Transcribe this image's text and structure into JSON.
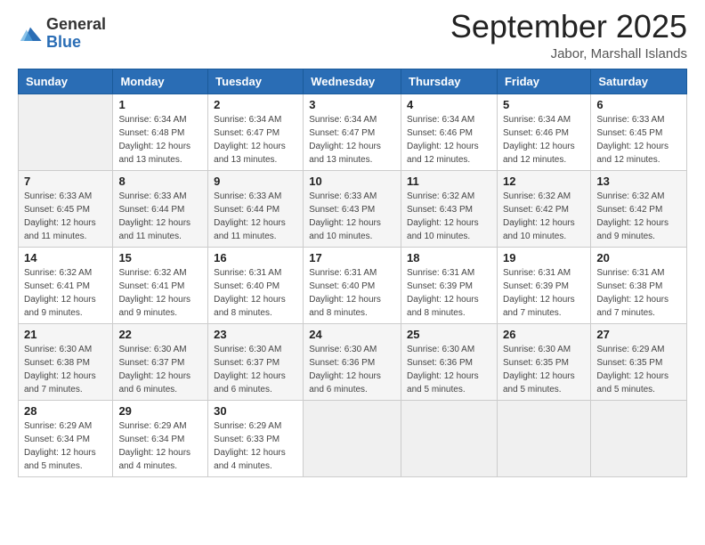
{
  "logo": {
    "general": "General",
    "blue": "Blue"
  },
  "title": "September 2025",
  "subtitle": "Jabor, Marshall Islands",
  "headers": [
    "Sunday",
    "Monday",
    "Tuesday",
    "Wednesday",
    "Thursday",
    "Friday",
    "Saturday"
  ],
  "weeks": [
    [
      {
        "day": "",
        "detail": ""
      },
      {
        "day": "1",
        "detail": "Sunrise: 6:34 AM\nSunset: 6:48 PM\nDaylight: 12 hours\nand 13 minutes."
      },
      {
        "day": "2",
        "detail": "Sunrise: 6:34 AM\nSunset: 6:47 PM\nDaylight: 12 hours\nand 13 minutes."
      },
      {
        "day": "3",
        "detail": "Sunrise: 6:34 AM\nSunset: 6:47 PM\nDaylight: 12 hours\nand 13 minutes."
      },
      {
        "day": "4",
        "detail": "Sunrise: 6:34 AM\nSunset: 6:46 PM\nDaylight: 12 hours\nand 12 minutes."
      },
      {
        "day": "5",
        "detail": "Sunrise: 6:34 AM\nSunset: 6:46 PM\nDaylight: 12 hours\nand 12 minutes."
      },
      {
        "day": "6",
        "detail": "Sunrise: 6:33 AM\nSunset: 6:45 PM\nDaylight: 12 hours\nand 12 minutes."
      }
    ],
    [
      {
        "day": "7",
        "detail": "Sunrise: 6:33 AM\nSunset: 6:45 PM\nDaylight: 12 hours\nand 11 minutes."
      },
      {
        "day": "8",
        "detail": "Sunrise: 6:33 AM\nSunset: 6:44 PM\nDaylight: 12 hours\nand 11 minutes."
      },
      {
        "day": "9",
        "detail": "Sunrise: 6:33 AM\nSunset: 6:44 PM\nDaylight: 12 hours\nand 11 minutes."
      },
      {
        "day": "10",
        "detail": "Sunrise: 6:33 AM\nSunset: 6:43 PM\nDaylight: 12 hours\nand 10 minutes."
      },
      {
        "day": "11",
        "detail": "Sunrise: 6:32 AM\nSunset: 6:43 PM\nDaylight: 12 hours\nand 10 minutes."
      },
      {
        "day": "12",
        "detail": "Sunrise: 6:32 AM\nSunset: 6:42 PM\nDaylight: 12 hours\nand 10 minutes."
      },
      {
        "day": "13",
        "detail": "Sunrise: 6:32 AM\nSunset: 6:42 PM\nDaylight: 12 hours\nand 9 minutes."
      }
    ],
    [
      {
        "day": "14",
        "detail": "Sunrise: 6:32 AM\nSunset: 6:41 PM\nDaylight: 12 hours\nand 9 minutes."
      },
      {
        "day": "15",
        "detail": "Sunrise: 6:32 AM\nSunset: 6:41 PM\nDaylight: 12 hours\nand 9 minutes."
      },
      {
        "day": "16",
        "detail": "Sunrise: 6:31 AM\nSunset: 6:40 PM\nDaylight: 12 hours\nand 8 minutes."
      },
      {
        "day": "17",
        "detail": "Sunrise: 6:31 AM\nSunset: 6:40 PM\nDaylight: 12 hours\nand 8 minutes."
      },
      {
        "day": "18",
        "detail": "Sunrise: 6:31 AM\nSunset: 6:39 PM\nDaylight: 12 hours\nand 8 minutes."
      },
      {
        "day": "19",
        "detail": "Sunrise: 6:31 AM\nSunset: 6:39 PM\nDaylight: 12 hours\nand 7 minutes."
      },
      {
        "day": "20",
        "detail": "Sunrise: 6:31 AM\nSunset: 6:38 PM\nDaylight: 12 hours\nand 7 minutes."
      }
    ],
    [
      {
        "day": "21",
        "detail": "Sunrise: 6:30 AM\nSunset: 6:38 PM\nDaylight: 12 hours\nand 7 minutes."
      },
      {
        "day": "22",
        "detail": "Sunrise: 6:30 AM\nSunset: 6:37 PM\nDaylight: 12 hours\nand 6 minutes."
      },
      {
        "day": "23",
        "detail": "Sunrise: 6:30 AM\nSunset: 6:37 PM\nDaylight: 12 hours\nand 6 minutes."
      },
      {
        "day": "24",
        "detail": "Sunrise: 6:30 AM\nSunset: 6:36 PM\nDaylight: 12 hours\nand 6 minutes."
      },
      {
        "day": "25",
        "detail": "Sunrise: 6:30 AM\nSunset: 6:36 PM\nDaylight: 12 hours\nand 5 minutes."
      },
      {
        "day": "26",
        "detail": "Sunrise: 6:30 AM\nSunset: 6:35 PM\nDaylight: 12 hours\nand 5 minutes."
      },
      {
        "day": "27",
        "detail": "Sunrise: 6:29 AM\nSunset: 6:35 PM\nDaylight: 12 hours\nand 5 minutes."
      }
    ],
    [
      {
        "day": "28",
        "detail": "Sunrise: 6:29 AM\nSunset: 6:34 PM\nDaylight: 12 hours\nand 5 minutes."
      },
      {
        "day": "29",
        "detail": "Sunrise: 6:29 AM\nSunset: 6:34 PM\nDaylight: 12 hours\nand 4 minutes."
      },
      {
        "day": "30",
        "detail": "Sunrise: 6:29 AM\nSunset: 6:33 PM\nDaylight: 12 hours\nand 4 minutes."
      },
      {
        "day": "",
        "detail": ""
      },
      {
        "day": "",
        "detail": ""
      },
      {
        "day": "",
        "detail": ""
      },
      {
        "day": "",
        "detail": ""
      }
    ]
  ]
}
